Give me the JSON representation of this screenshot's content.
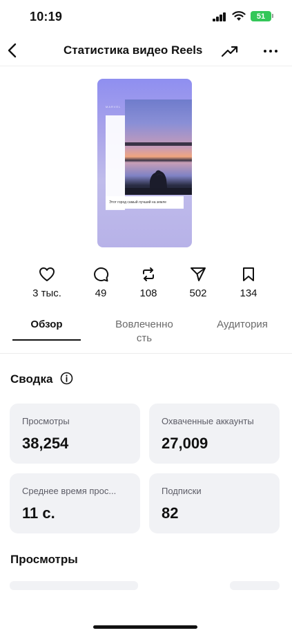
{
  "status_bar": {
    "time": "10:19",
    "battery": "51"
  },
  "header": {
    "title": "Статистика видео Reels"
  },
  "reel": {
    "caption": "Этот город самый лучший на земле",
    "brand": "MARVEL"
  },
  "stats": [
    {
      "icon": "heart-icon",
      "value": "3 тыс."
    },
    {
      "icon": "comment-icon",
      "value": "49"
    },
    {
      "icon": "repost-icon",
      "value": "108"
    },
    {
      "icon": "share-icon",
      "value": "502"
    },
    {
      "icon": "bookmark-icon",
      "value": "134"
    }
  ],
  "tabs": [
    {
      "label": "Обзор",
      "active": true
    },
    {
      "label": "Вовлеченно сть",
      "active": false
    },
    {
      "label": "Аудитория",
      "active": false
    }
  ],
  "summary": {
    "title": "Сводка",
    "cards": [
      {
        "label": "Просмотры",
        "value": "38,254"
      },
      {
        "label": "Охваченные аккаунты",
        "value": "27,009"
      },
      {
        "label": "Среднее время прос...",
        "value": "11 с."
      },
      {
        "label": "Подписки",
        "value": "82"
      }
    ]
  },
  "views_section": {
    "title": "Просмотры"
  },
  "colors": {
    "battery": "#34c759",
    "card_bg": "#f1f2f5",
    "text": "#111111"
  }
}
